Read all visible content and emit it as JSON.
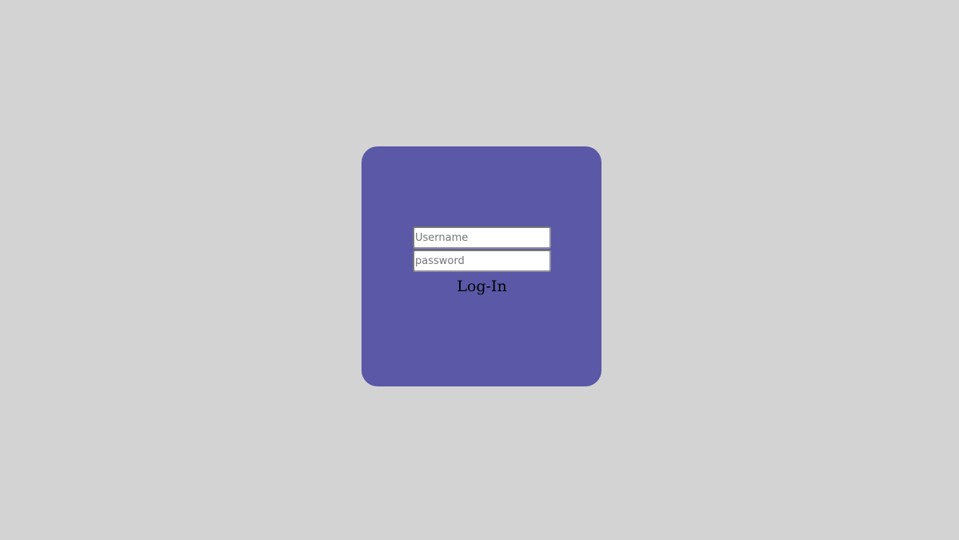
{
  "colors": {
    "page_background": "#d3d3d3",
    "card_background": "#5a58a7"
  },
  "login": {
    "username_placeholder": "Username",
    "username_value": "",
    "password_placeholder": "password",
    "password_value": "",
    "submit_label": "Log-In"
  }
}
